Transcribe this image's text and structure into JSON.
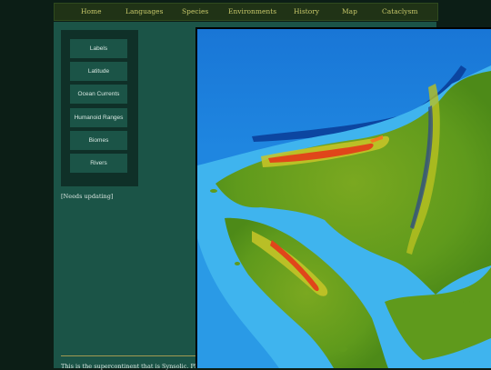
{
  "nav": {
    "items": [
      {
        "label": "Home"
      },
      {
        "label": "Languages"
      },
      {
        "label": "Species"
      },
      {
        "label": "Environments"
      },
      {
        "label": "History"
      },
      {
        "label": "Map"
      },
      {
        "label": "Cataclysm"
      }
    ]
  },
  "layers": {
    "buttons": [
      {
        "label": "Labels"
      },
      {
        "label": "Latitude"
      },
      {
        "label": "Ocean Currents"
      },
      {
        "label": "Humanoid Ranges"
      },
      {
        "label": "Biomes"
      },
      {
        "label": "Rivers"
      }
    ]
  },
  "note": "[Needs updating]",
  "description": "This is the supercontinent that is Synsolic. Place name",
  "colors": {
    "nav_bg": "#203316",
    "nav_text": "#c7c86a",
    "content_bg": "#1b5447",
    "panel_bg": "#0f3028",
    "ocean_deep": "#0b56b8",
    "land_green": "#5f9a1c",
    "mountain_red": "#e0461a"
  }
}
